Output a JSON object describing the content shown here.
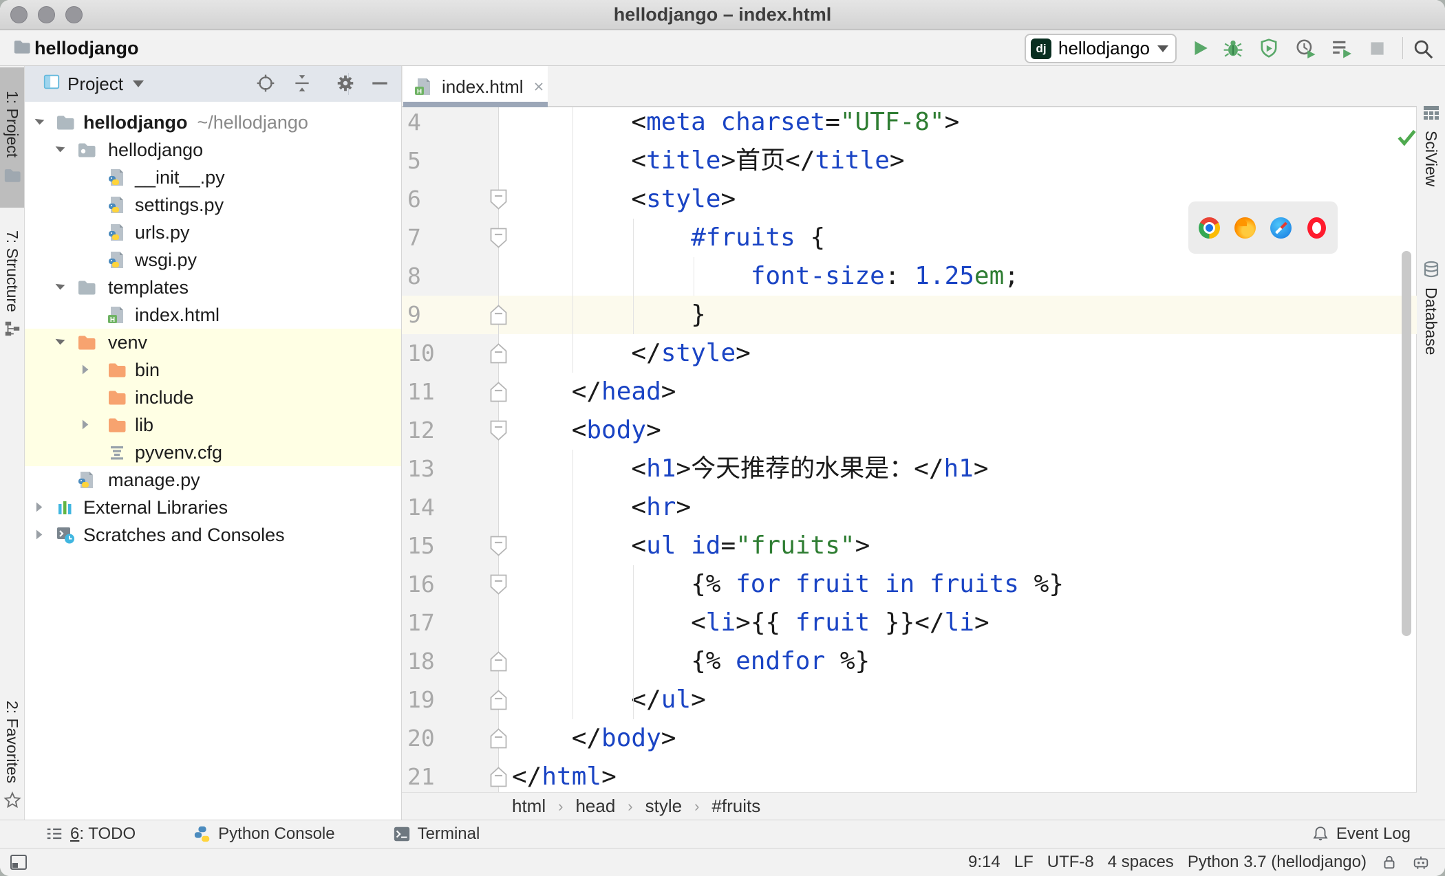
{
  "window": {
    "title": "hellodjango – index.html"
  },
  "toolbar": {
    "project_name": "hellodjango",
    "run_config": {
      "badge": "dj",
      "name": "hellodjango"
    },
    "buttons": [
      "run",
      "debug",
      "run-with-coverage",
      "profiler",
      "run-list",
      "stop",
      "search-everywhere"
    ]
  },
  "left_stripe": {
    "items": [
      {
        "label": "1: Project",
        "icon": "tool-folder",
        "active": true
      },
      {
        "label": "7: Structure",
        "icon": "structure",
        "active": false
      },
      {
        "label": "2: Favorites",
        "icon": "star",
        "active": false
      }
    ]
  },
  "right_stripe": {
    "items": [
      {
        "label": "SciView",
        "icon": "grid"
      },
      {
        "label": "Database",
        "icon": "database"
      }
    ]
  },
  "project_panel": {
    "header": {
      "title": "Project"
    },
    "tree": [
      {
        "label": "hellodjango",
        "suffix": "~/hellodjango",
        "level": 0,
        "icon": "folder",
        "arrow": "down",
        "bold": true
      },
      {
        "label": "hellodjango",
        "level": 1,
        "icon": "folder-pkg",
        "arrow": "down"
      },
      {
        "label": "__init__.py",
        "level": 2,
        "icon": "py-file"
      },
      {
        "label": "settings.py",
        "level": 2,
        "icon": "py-file"
      },
      {
        "label": "urls.py",
        "level": 2,
        "icon": "py-file"
      },
      {
        "label": "wsgi.py",
        "level": 2,
        "icon": "py-file"
      },
      {
        "label": "templates",
        "level": 1,
        "icon": "folder",
        "arrow": "down"
      },
      {
        "label": "index.html",
        "level": 2,
        "icon": "html-file"
      },
      {
        "label": "venv",
        "level": 1,
        "icon": "folder-orange",
        "arrow": "down",
        "hl": true
      },
      {
        "label": "bin",
        "level": 2,
        "icon": "folder-orange",
        "arrow": "right",
        "hl": true
      },
      {
        "label": "include",
        "level": 2,
        "icon": "folder-orange",
        "hl": true
      },
      {
        "label": "lib",
        "level": 2,
        "icon": "folder-orange",
        "arrow": "right",
        "hl": true
      },
      {
        "label": "pyvenv.cfg",
        "level": 2,
        "icon": "cfg-file",
        "hl": true
      },
      {
        "label": "manage.py",
        "level": 1,
        "icon": "py-file"
      },
      {
        "label": "External Libraries",
        "level": 0,
        "icon": "ext-lib",
        "arrow": "right"
      },
      {
        "label": "Scratches and Consoles",
        "level": 0,
        "icon": "scratches",
        "arrow": "right"
      }
    ]
  },
  "editor": {
    "tab": {
      "label": "index.html"
    },
    "breadcrumbs": [
      "html",
      "head",
      "style",
      "#fruits"
    ],
    "lines": [
      {
        "n": 4,
        "fold": "none",
        "tokens": [
          [
            "        <",
            "p"
          ],
          [
            "meta",
            "t"
          ],
          [
            " ",
            "p"
          ],
          [
            "charset",
            "t"
          ],
          [
            "=",
            "p"
          ],
          [
            "\"UTF-8\"",
            "s"
          ],
          [
            ">",
            "p"
          ]
        ]
      },
      {
        "n": 5,
        "fold": "none",
        "tokens": [
          [
            "        <",
            "p"
          ],
          [
            "title",
            "t"
          ],
          [
            ">",
            "p"
          ],
          [
            "首页",
            "p"
          ],
          [
            "</",
            "p"
          ],
          [
            "title",
            "t"
          ],
          [
            ">",
            "p"
          ]
        ]
      },
      {
        "n": 6,
        "fold": "start",
        "tokens": [
          [
            "        <",
            "p"
          ],
          [
            "style",
            "t"
          ],
          [
            ">",
            "p"
          ]
        ]
      },
      {
        "n": 7,
        "fold": "start",
        "tokens": [
          [
            "            ",
            "p"
          ],
          [
            "#fruits",
            "t"
          ],
          [
            " {",
            "p"
          ]
        ]
      },
      {
        "n": 8,
        "fold": "none",
        "tokens": [
          [
            "                ",
            "p"
          ],
          [
            "font-size",
            "t"
          ],
          [
            ": ",
            "p"
          ],
          [
            "1.25",
            "t"
          ],
          [
            "em",
            "s"
          ],
          [
            ";",
            "p"
          ]
        ]
      },
      {
        "n": 9,
        "fold": "end",
        "tokens": [
          [
            "            }",
            "p"
          ]
        ]
      },
      {
        "n": 10,
        "fold": "end",
        "tokens": [
          [
            "        </",
            "p"
          ],
          [
            "style",
            "t"
          ],
          [
            ">",
            "p"
          ]
        ]
      },
      {
        "n": 11,
        "fold": "end",
        "tokens": [
          [
            "    </",
            "p"
          ],
          [
            "head",
            "t"
          ],
          [
            ">",
            "p"
          ]
        ]
      },
      {
        "n": 12,
        "fold": "start",
        "tokens": [
          [
            "    <",
            "p"
          ],
          [
            "body",
            "t"
          ],
          [
            ">",
            "p"
          ]
        ]
      },
      {
        "n": 13,
        "fold": "none",
        "tokens": [
          [
            "        <",
            "p"
          ],
          [
            "h1",
            "t"
          ],
          [
            ">",
            "p"
          ],
          [
            "今天推荐的水果是：",
            "p"
          ],
          [
            "</",
            "p"
          ],
          [
            "h1",
            "t"
          ],
          [
            ">",
            "p"
          ]
        ]
      },
      {
        "n": 14,
        "fold": "none",
        "tokens": [
          [
            "        <",
            "p"
          ],
          [
            "hr",
            "t"
          ],
          [
            ">",
            "p"
          ]
        ]
      },
      {
        "n": 15,
        "fold": "start",
        "tokens": [
          [
            "        <",
            "p"
          ],
          [
            "ul",
            "t"
          ],
          [
            " ",
            "p"
          ],
          [
            "id",
            "t"
          ],
          [
            "=",
            "p"
          ],
          [
            "\"fruits\"",
            "s"
          ],
          [
            ">",
            "p"
          ]
        ]
      },
      {
        "n": 16,
        "fold": "start",
        "tokens": [
          [
            "            {% ",
            "p"
          ],
          [
            "for",
            "k"
          ],
          [
            " ",
            "p"
          ],
          [
            "fruit",
            "v"
          ],
          [
            " ",
            "p"
          ],
          [
            "in",
            "k"
          ],
          [
            " ",
            "p"
          ],
          [
            "fruits",
            "v"
          ],
          [
            " %}",
            "p"
          ]
        ]
      },
      {
        "n": 17,
        "fold": "none",
        "tokens": [
          [
            "            <",
            "p"
          ],
          [
            "li",
            "t"
          ],
          [
            ">",
            "p"
          ],
          [
            "{{ ",
            "p"
          ],
          [
            "fruit",
            "v"
          ],
          [
            " }}",
            "p"
          ],
          [
            "</",
            "p"
          ],
          [
            "li",
            "t"
          ],
          [
            ">",
            "p"
          ]
        ]
      },
      {
        "n": 18,
        "fold": "end",
        "tokens": [
          [
            "            {% ",
            "p"
          ],
          [
            "endfor",
            "k"
          ],
          [
            " %}",
            "p"
          ]
        ]
      },
      {
        "n": 19,
        "fold": "end",
        "tokens": [
          [
            "        </",
            "p"
          ],
          [
            "ul",
            "t"
          ],
          [
            ">",
            "p"
          ]
        ]
      },
      {
        "n": 20,
        "fold": "end",
        "tokens": [
          [
            "    </",
            "p"
          ],
          [
            "body",
            "t"
          ],
          [
            ">",
            "p"
          ]
        ]
      },
      {
        "n": 21,
        "fold": "end",
        "tokens": [
          [
            "</",
            "p"
          ],
          [
            "html",
            "t"
          ],
          [
            ">",
            "p"
          ]
        ]
      }
    ]
  },
  "browser_popup": {
    "browsers": [
      "chrome",
      "firefox",
      "safari",
      "opera"
    ]
  },
  "bottom_bar": {
    "items": [
      {
        "label": "6: TODO",
        "icon": "todo-list"
      },
      {
        "label": "Python Console",
        "icon": "py-console"
      },
      {
        "label": "Terminal",
        "icon": "terminal"
      }
    ],
    "right": {
      "label": "Event Log",
      "icon": "bell"
    }
  },
  "status_bar": {
    "items": [
      "9:14",
      "LF",
      "UTF-8",
      "4 spaces",
      "Python 3.7 (hellodjango)"
    ]
  },
  "colors": {
    "dj_badge": "#092e20",
    "tree_highlight": "#ffffe4",
    "current_line": "#fcfaed",
    "tab_underline": "#9ca7b8",
    "folder_gray": "#aeb9c0",
    "folder_orange": "#f7a36f",
    "code_blue": "#1a44c4",
    "code_green": "#2e7d32",
    "run_green": "#59a869"
  }
}
